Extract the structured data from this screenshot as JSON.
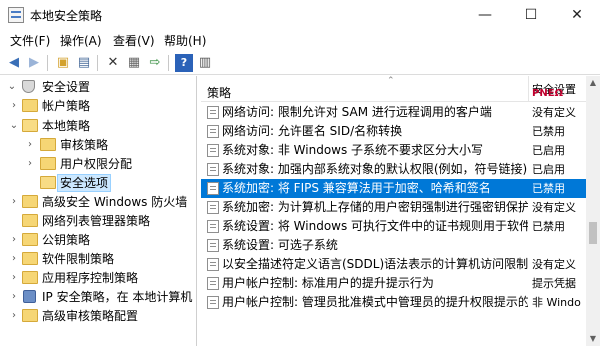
{
  "window": {
    "title": "本地安全策略",
    "minimize": "—",
    "maximize": "☐",
    "close": "✕"
  },
  "menu": [
    "文件(F)",
    "操作(A)",
    "查看(V)",
    "帮助(H)"
  ],
  "toolbar": {
    "icons": [
      "back-arrow-icon",
      "forward-arrow-icon",
      "up-folder-icon",
      "show-hide-tree-icon",
      "delete-icon",
      "properties-icon",
      "export-list-icon",
      "help-icon",
      "help-topics-icon"
    ]
  },
  "tree": [
    {
      "label": "安全设置",
      "expander": "⌄",
      "icon": "shield",
      "level": 0
    },
    {
      "label": "帐户策略",
      "expander": "›",
      "icon": "folder",
      "level": 1
    },
    {
      "label": "本地策略",
      "expander": "⌄",
      "icon": "folder-open",
      "level": 1
    },
    {
      "label": "审核策略",
      "expander": "›",
      "icon": "folder",
      "level": 2
    },
    {
      "label": "用户权限分配",
      "expander": "›",
      "icon": "folder",
      "level": 2
    },
    {
      "label": "安全选项",
      "expander": "",
      "icon": "folder-open",
      "level": 2,
      "selected": true
    },
    {
      "label": "高级安全 Windows 防火墙",
      "expander": "›",
      "icon": "folder",
      "level": 1
    },
    {
      "label": "网络列表管理器策略",
      "expander": "",
      "icon": "folder",
      "level": 1
    },
    {
      "label": "公钥策略",
      "expander": "›",
      "icon": "folder",
      "level": 1
    },
    {
      "label": "软件限制策略",
      "expander": "›",
      "icon": "folder",
      "level": 1
    },
    {
      "label": "应用程序控制策略",
      "expander": "›",
      "icon": "folder",
      "level": 1
    },
    {
      "label": "IP 安全策略，在 本地计算机",
      "expander": "›",
      "icon": "ip",
      "level": 1
    },
    {
      "label": "高级审核策略配置",
      "expander": "›",
      "icon": "folder",
      "level": 1
    }
  ],
  "list": {
    "col_policy": "策略",
    "col_setting": "安全设置",
    "col_setting_overlay": "ΡΝΕΩ",
    "rows": [
      {
        "policy": "网络访问: 限制允许对 SAM 进行远程调用的客户端",
        "setting": "没有定义"
      },
      {
        "policy": "网络访问: 允许匿名 SID/名称转换",
        "setting": "已禁用"
      },
      {
        "policy": "系统对象: 非 Windows 子系统不要求区分大小写",
        "setting": "已启用"
      },
      {
        "policy": "系统对象: 加强内部系统对象的默认权限(例如，符号链接)",
        "setting": "已启用"
      },
      {
        "policy": "系统加密: 将 FIPS 兼容算法用于加密、哈希和签名",
        "setting": "已禁用",
        "selected": true
      },
      {
        "policy": "系统加密: 为计算机上存储的用户密钥强制进行强密钥保护",
        "setting": "没有定义"
      },
      {
        "policy": "系统设置: 将 Windows 可执行文件中的证书规则用于软件...",
        "setting": "已禁用"
      },
      {
        "policy": "系统设置: 可选子系统",
        "setting": ""
      },
      {
        "policy": "以安全描述符定义语言(SDDL)语法表示的计算机访问限制",
        "setting": "没有定义"
      },
      {
        "policy": "用户帐户控制: 标准用户的提升提示行为",
        "setting": "提示凭据"
      },
      {
        "policy": "用户帐户控制: 管理员批准模式中管理员的提升权限提示的...",
        "setting": "非 Windo"
      }
    ]
  }
}
